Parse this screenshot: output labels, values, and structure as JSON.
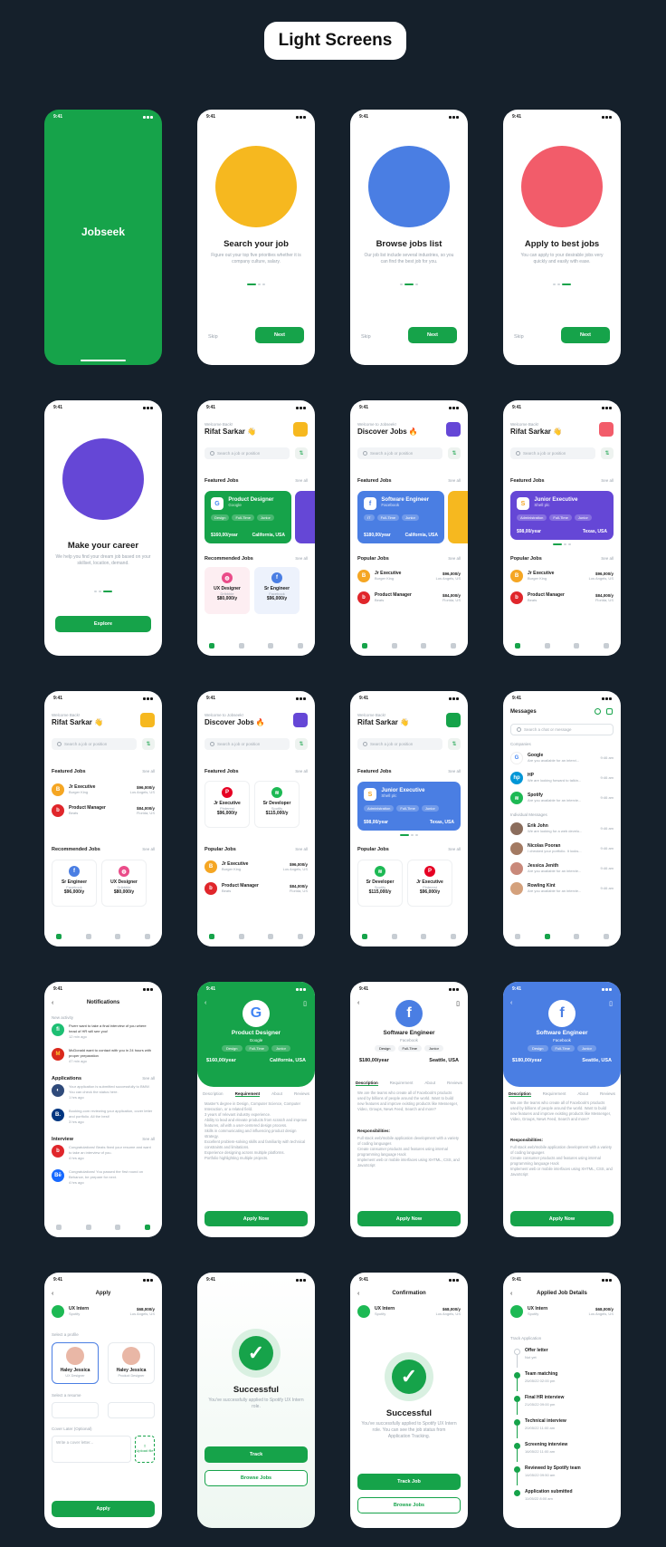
{
  "page_title": "Light Screens",
  "status_time": "9:41",
  "colors": {
    "brand": "#16a34a",
    "facebook_blue": "#4a7ee3",
    "purple": "#6547d6",
    "background": "#15202b"
  },
  "splash": {
    "app_name": "Jobseek"
  },
  "onboarding": [
    {
      "title": "Search your job",
      "text": "Figure out your top five priorities whether it is company culture, salary.",
      "skip": "Skip",
      "cta": "Next"
    },
    {
      "title": "Browse jobs list",
      "text": "Our job list include several industries, so you can find the best job for you.",
      "skip": "Skip",
      "cta": "Next"
    },
    {
      "title": "Apply to best jobs",
      "text": "You can apply to your desirable jobs very quickly and easily with ease.",
      "skip": "Skip",
      "cta": "Next"
    },
    {
      "title": "Make your career",
      "text": "We help you find your dream job based on your skillset, location, demand.",
      "cta": "Explore"
    }
  ],
  "home": {
    "greeting": "Welcome Back!",
    "greeting_alt": "Welcome to Jobseek!",
    "user": "Rifat Sarkar 👋",
    "discover": "Discover Jobs 🔥",
    "search_placeholder": "Search a job or position",
    "featured": "Featured Jobs",
    "see_all": "See all",
    "recommended": "Recommended Jobs",
    "popular": "Popular Jobs",
    "featured_cards": [
      {
        "title": "Product Designer",
        "company": "Google",
        "chips": [
          "Design",
          "Full-Time",
          "Junior"
        ],
        "salary": "$160,00/year",
        "location": "California, USA",
        "logo": "G"
      },
      {
        "title": "Software Engineer",
        "company": "Facebook",
        "chips": [
          "IT",
          "Full-Time",
          "Junior"
        ],
        "salary": "$180,00/year",
        "location": "California, USA",
        "logo": "f"
      },
      {
        "title": "Junior Executive",
        "company": "Shell plc",
        "chips": [
          "Administration",
          "Full-Time",
          "Junior"
        ],
        "salary": "$98,00/year",
        "location": "Texas, USA",
        "logo": "S"
      }
    ],
    "recommended_cards": [
      {
        "title": "UX Designer",
        "company": "Dribbble",
        "salary": "$80,000/y"
      },
      {
        "title": "Sr Engineer",
        "company": "Facebook",
        "salary": "$96,000/y"
      }
    ],
    "popular_list": [
      {
        "title": "Jr Executive",
        "company": "Burger King",
        "salary": "$96,000/y",
        "location": "Los Angels, US"
      },
      {
        "title": "Product Manager",
        "company": "Beats",
        "salary": "$84,000/y",
        "location": "Florida, US"
      }
    ],
    "mini_cards_2": [
      {
        "title": "Jr Executive",
        "company": "Pinterest",
        "salary": "$96,000/y"
      },
      {
        "title": "Sr Developer",
        "company": "Spotify",
        "salary": "$115,000/y"
      }
    ]
  },
  "messages": {
    "title": "Messages",
    "search_placeholder": "Search a chat or message",
    "companies_label": "Companies",
    "individual_label": "Individual Messages",
    "companies": [
      {
        "name": "Google",
        "text": "Are you available for an intervi...",
        "time": "9:46 am"
      },
      {
        "name": "HP",
        "text": "We are looking forward to talkin...",
        "time": "9:46 am"
      },
      {
        "name": "Spotify",
        "text": "Are you available for an intervie...",
        "time": "9:46 am"
      }
    ],
    "individuals": [
      {
        "name": "Erik John",
        "text": "We are looking for a web develo...",
        "time": "9:46 am"
      },
      {
        "name": "Nicolas Pooran",
        "text": "I checked your portfolio. It looks...",
        "time": "9:46 am"
      },
      {
        "name": "Jessica Jenith",
        "text": "Are you available for an intervie...",
        "time": "9:46 am"
      },
      {
        "name": "Rowling Kint",
        "text": "Are you available for an intervie...",
        "time": "9:46 am"
      }
    ]
  },
  "notifications": {
    "title": "Notifications",
    "new_label": "New activity",
    "applications_label": "Applications",
    "interview_label": "Interview",
    "see_all": "See all",
    "items": [
      {
        "text": "Fiverr want to take a final interview of you where head of HR will see you!",
        "time": "12 min ago"
      },
      {
        "text": "McDonald want to contact with you in 24 hours with proper preparation",
        "time": "47 min ago"
      },
      {
        "text": "Your application is submitted successfully to BMW. You can check the status here.",
        "time": "1 hrs ago"
      },
      {
        "text": "Booking.com reviewing your application, cover letter and portfolio. All the best!",
        "time": "3 hrs ago"
      },
      {
        "text": "Congratulations! Beats fixed your resume and want to take an interview of you.",
        "time": "4 hrs ago"
      },
      {
        "text": "Congratulations! You passed the first round on Behance, be prepare for next.",
        "time": "4 hrs ago"
      }
    ]
  },
  "details": {
    "tabs": [
      "Description",
      "Requirement",
      "About",
      "Reviews"
    ],
    "requirements": [
      "Master's degree in Design, Computer Science, Computer Interaction, or a related field.",
      "3 years of relevant industry experience.",
      "Ability to lead and elevate products from scratch and improve features, all with a user-centered design process.",
      "Skills in communicating and influencing product design strategy.",
      "Excellent problem-solving skills and familiarity with technical constraints and limitations.",
      "Experience designing across multiple platforms.",
      "Portfolio highlighting multiple projects."
    ],
    "description": "We are the teams who create all of Facebook's products used by billions of people around the world. Want to build new features and improve existing products like Messenger, Video, Groups, News Feed, Search and more?",
    "responsibilities_label": "Responsibilities:",
    "responsibilities": [
      "Full stack web/mobile application development with a variety of coding languages",
      "Create consumer products and features using internal programming language Hack",
      "Implement web or mobile interfaces using XHTML, CSS, and JavaScript"
    ],
    "fb": {
      "title": "Software Engineer",
      "company": "Facebook",
      "chips": [
        "Design",
        "Full-Time",
        "Junior"
      ],
      "salary": "$180,00/year",
      "location": "Seattle, USA"
    },
    "google": {
      "title": "Product Designer",
      "company": "Google",
      "chips": [
        "Design",
        "Full-Time",
        "Junior"
      ],
      "salary": "$160,00/year",
      "location": "California, USA"
    },
    "cta": "Apply Now"
  },
  "apply": {
    "title": "Apply",
    "job": {
      "title": "UX Intern",
      "company": "Spotify",
      "salary": "$68,000/y",
      "location": "Los Angels, US"
    },
    "select_profile": "Select a profile",
    "profiles": [
      {
        "name": "Haley Jessica",
        "role": "UX Designer"
      },
      {
        "name": "Haley Jessica",
        "role": "Product Designer"
      }
    ],
    "select_resume": "Select a resume",
    "cover_label": "Cover Later",
    "cover_optional": "(Optional)",
    "cover_placeholder": "Write a cover letter...",
    "upload": "Upload file",
    "cta": "Apply"
  },
  "success": {
    "title": "Successful",
    "text": "You've successfully applied to Spotify UX Intern role.",
    "track": "Track",
    "browse": "Browse Jobs"
  },
  "confirmation": {
    "title": "Confirmation",
    "success_title": "Successful",
    "text": "You've successfully applied to Spotify UX Intern role. You can see the job status from Application Tracking.",
    "track": "Track Job",
    "browse": "Browse Jobs"
  },
  "tracking": {
    "title": "Applied Job Details",
    "track_label": "Track Application",
    "steps": [
      {
        "title": "Offer letter",
        "date": "Not yet",
        "done": false
      },
      {
        "title": "Team matching",
        "date": "25/05/22   02:00 pm",
        "done": true
      },
      {
        "title": "Final HR interview",
        "date": "21/05/22   09:00 pm",
        "done": true
      },
      {
        "title": "Technical interview",
        "date": "20/05/22   11:00 am",
        "done": true
      },
      {
        "title": "Screening interview",
        "date": "16/05/22   11:00 am",
        "done": true
      },
      {
        "title": "Reviewed by Spotify team",
        "date": "14/05/22   09:50 am",
        "done": true
      },
      {
        "title": "Application submitted",
        "date": "11/05/22   8:00 am",
        "done": true
      }
    ]
  }
}
